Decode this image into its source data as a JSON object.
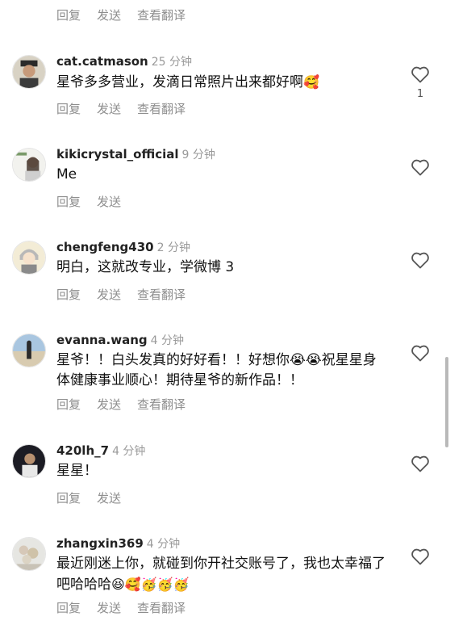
{
  "top_actions": {
    "reply": "回复",
    "send": "发送",
    "translate": "查看翻译"
  },
  "comments": [
    {
      "username": "cat.catmason",
      "time": "25 分钟",
      "text": "星爷多多营业，发滴日常照片出来都好啊",
      "emojis": "🥰",
      "reply": "回复",
      "send": "发送",
      "translate": "查看翻译",
      "likes": "1",
      "avatar": "man-with-cap"
    },
    {
      "username": "kikicrystal_official",
      "time": "9 分钟",
      "text": "Me",
      "reply": "回复",
      "send": "发送",
      "avatar": "woman-portrait"
    },
    {
      "username": "chengfeng430",
      "time": "2 分钟",
      "text": "明白，这就改专业，学微博 3",
      "reply": "回复",
      "send": "发送",
      "translate": "查看翻译",
      "avatar": "cartoon-boy"
    },
    {
      "username": "evanna.wang",
      "time": "4 分钟",
      "text": "星爷！！白头发真的好好看！！好想你😭😭祝星星身体健康事业顺心！期待星爷的新作品！！",
      "reply": "回复",
      "send": "发送",
      "translate": "查看翻译",
      "avatar": "beach-figure"
    },
    {
      "username": "420lh_7",
      "time": "4 分钟",
      "text": "星星！",
      "reply": "回复",
      "send": "发送",
      "avatar": "dark-photo"
    },
    {
      "username": "zhangxin369",
      "time": "4 分钟",
      "text": "最近刚迷上你，就碰到你开社交账号了，我也太幸福了吧哈哈哈",
      "emojis": "😆🥰🥳🥳🥳",
      "reply": "回复",
      "send": "发送",
      "translate": "查看翻译",
      "avatar": "flower-bouquet"
    }
  ]
}
